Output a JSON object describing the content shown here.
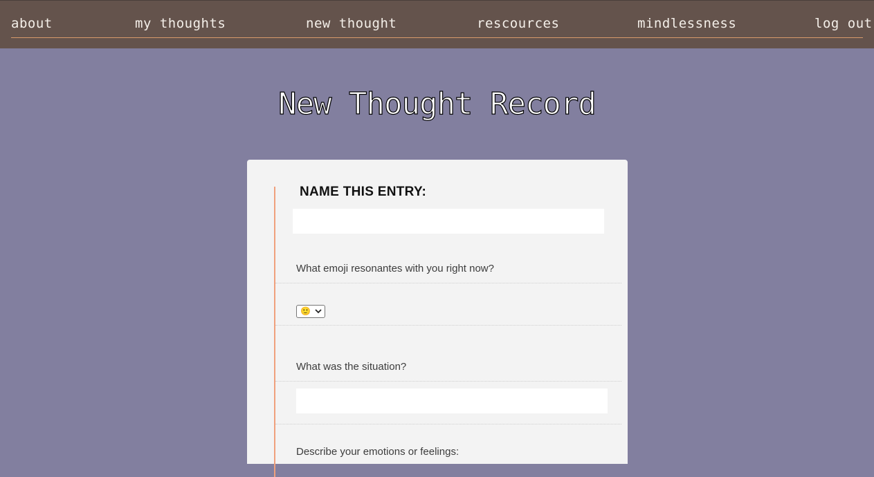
{
  "nav": {
    "about": "about",
    "my_thoughts": "my thoughts",
    "new_thought": "new thought",
    "resources": "rescources",
    "mindlessness": "mindlessness",
    "logout": "log out"
  },
  "page_title": "New Thought Record",
  "form": {
    "entry_label": "NAME THIS ENTRY:",
    "entry_value": "",
    "emoji_question": "What emoji resonantes with you right now?",
    "emoji_selected": "🙂",
    "situation_question": "What was the situation?",
    "situation_value": "",
    "emotions_question": "Describe your emotions or feelings:"
  },
  "colors": {
    "background": "#827f9f",
    "navbar": "#64534c",
    "accent": "#f0a07c",
    "card": "#f3f3f3"
  }
}
